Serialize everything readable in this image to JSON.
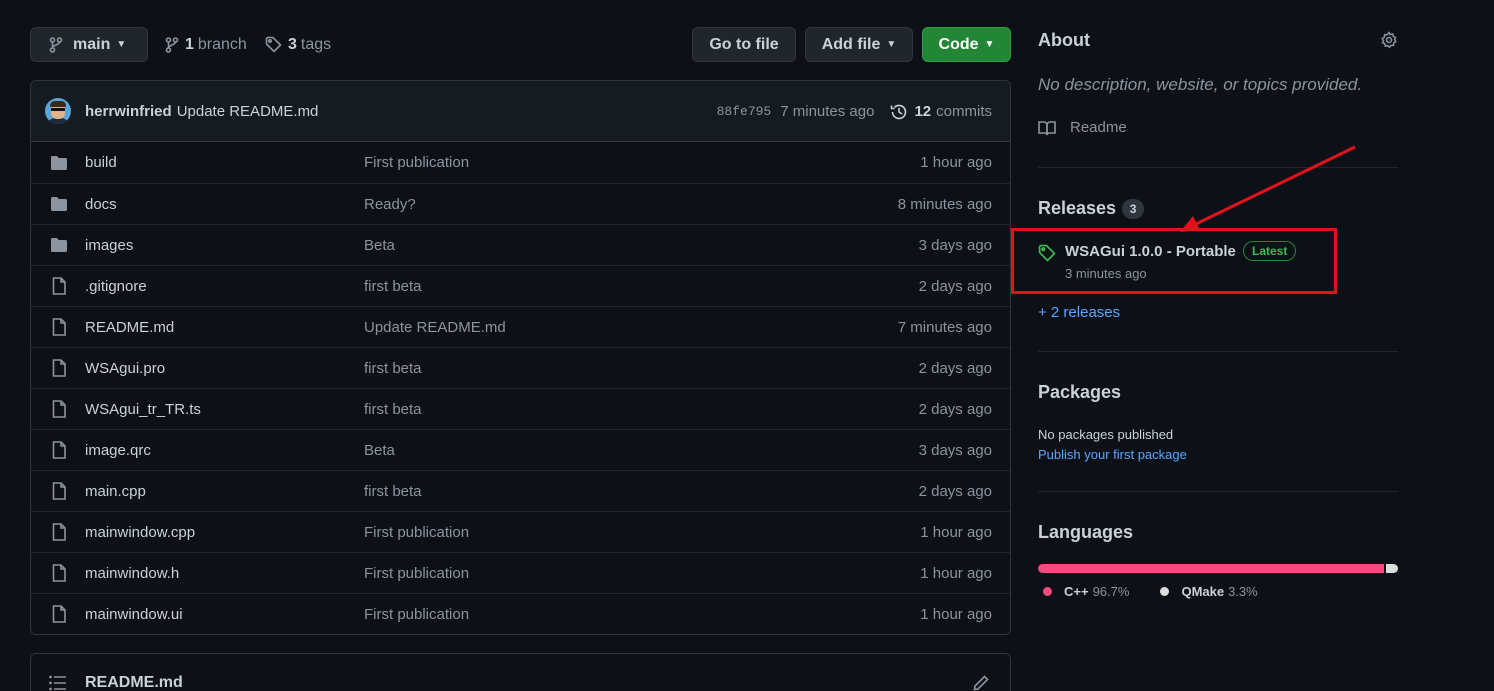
{
  "toolbar": {
    "branch_label": "main",
    "branch_count": "1",
    "branch_word": "branch",
    "tag_count": "3",
    "tag_word": "tags",
    "goto_label": "Go to file",
    "addfile_label": "Add file",
    "code_label": "Code"
  },
  "commit": {
    "author": "herrwinfried",
    "message": "Update README.md",
    "sha": "88fe795",
    "time": "7 minutes ago",
    "commit_count": "12",
    "commit_word": "commits"
  },
  "files": [
    {
      "type": "folder",
      "name": "build",
      "message": "First publication",
      "age": "1 hour ago"
    },
    {
      "type": "folder",
      "name": "docs",
      "message": "Ready?",
      "age": "8 minutes ago"
    },
    {
      "type": "folder",
      "name": "images",
      "message": "Beta",
      "age": "3 days ago"
    },
    {
      "type": "file",
      "name": ".gitignore",
      "message": "first beta",
      "age": "2 days ago"
    },
    {
      "type": "file",
      "name": "README.md",
      "message": "Update README.md",
      "age": "7 minutes ago"
    },
    {
      "type": "file",
      "name": "WSAgui.pro",
      "message": "first beta",
      "age": "2 days ago"
    },
    {
      "type": "file",
      "name": "WSAgui_tr_TR.ts",
      "message": "first beta",
      "age": "2 days ago"
    },
    {
      "type": "file",
      "name": "image.qrc",
      "message": "Beta",
      "age": "3 days ago"
    },
    {
      "type": "file",
      "name": "main.cpp",
      "message": "first beta",
      "age": "2 days ago"
    },
    {
      "type": "file",
      "name": "mainwindow.cpp",
      "message": "First publication",
      "age": "1 hour ago"
    },
    {
      "type": "file",
      "name": "mainwindow.h",
      "message": "First publication",
      "age": "1 hour ago"
    },
    {
      "type": "file",
      "name": "mainwindow.ui",
      "message": "First publication",
      "age": "1 hour ago"
    }
  ],
  "readme": {
    "title": "README.md"
  },
  "sidebar": {
    "about_title": "About",
    "about_desc": "No description, website, or topics provided.",
    "readme_link": "Readme",
    "releases_title": "Releases",
    "releases_count": "3",
    "release_name": "WSAGui 1.0.0 - Portable",
    "release_badge": "Latest",
    "release_time": "3 minutes ago",
    "more_releases": "+ 2 releases",
    "packages_title": "Packages",
    "packages_none": "No packages published",
    "packages_link": "Publish your first package",
    "languages_title": "Languages",
    "languages": [
      {
        "name": "C++",
        "percent": "96.7%",
        "value": 96.7,
        "color": "#f34b7d"
      },
      {
        "name": "QMake",
        "percent": "3.3%",
        "value": 3.3,
        "color": "#dddddd"
      }
    ]
  },
  "colors": {
    "background": "#0d1117",
    "accent_green": "#238636",
    "link_blue": "#58a6ff",
    "annotation_red": "#e0121b"
  }
}
